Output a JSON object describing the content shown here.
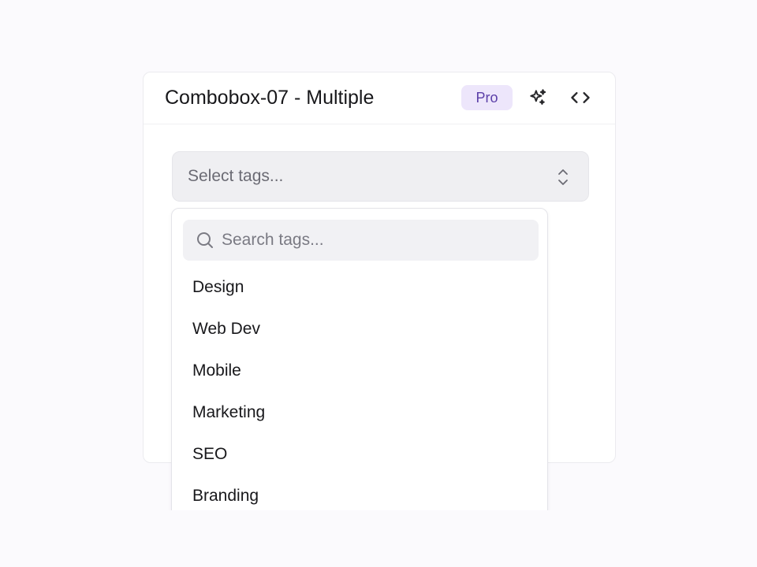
{
  "card": {
    "title": "Combobox-07 - Multiple",
    "badge": "Pro",
    "icons": [
      "sparkle-icon",
      "code-icon"
    ]
  },
  "combobox": {
    "placeholder": "Select tags...",
    "icon": "chevron-up-down-icon"
  },
  "dropdown": {
    "search_placeholder": "Search tags...",
    "search_icon": "search-icon",
    "options": [
      "Design",
      "Web Dev",
      "Mobile",
      "Marketing",
      "SEO",
      "Branding"
    ]
  },
  "colors": {
    "badge_bg": "#ede6fb",
    "badge_text": "#5b3fa8",
    "trigger_bg": "#efeff2"
  }
}
